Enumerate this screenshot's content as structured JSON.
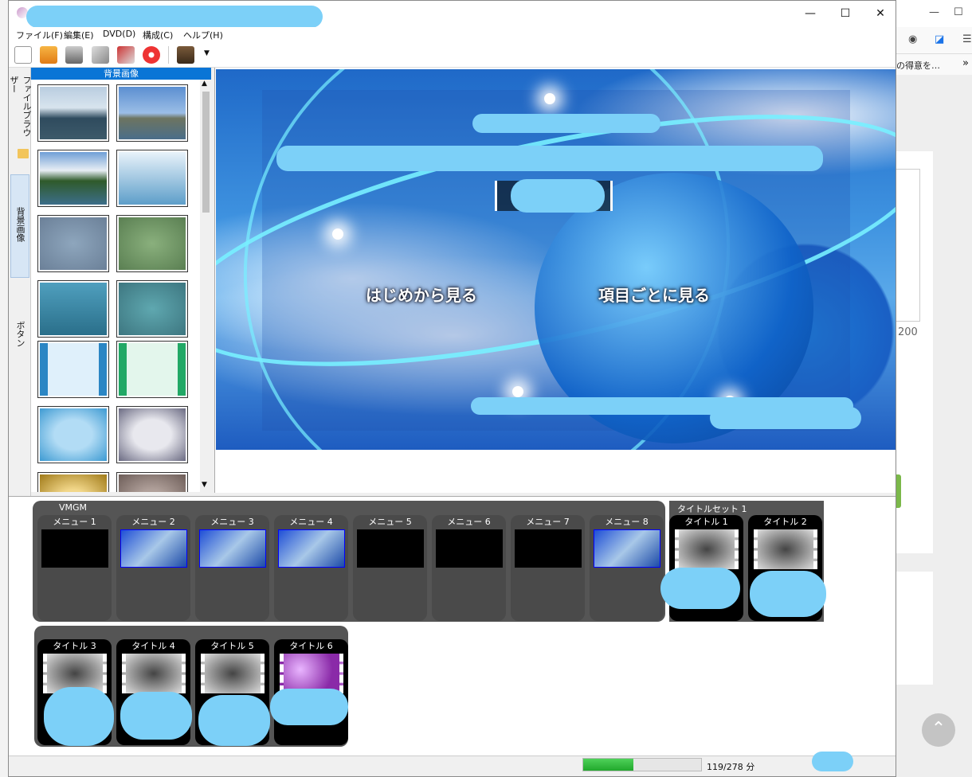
{
  "window": {
    "menu": [
      "ファイル(F)",
      "編集(E)",
      "DVD(D)",
      "構成(C)",
      "ヘルプ(H)"
    ],
    "controls": {
      "minimize": "—",
      "maximize": "☐",
      "close": "✕"
    }
  },
  "side_tabs": {
    "file_browser": "ファイルブラウザー",
    "background": "背景画像",
    "button": "ボタン"
  },
  "pane": {
    "header": "背景画像"
  },
  "preview": {
    "btn_from_start": "はじめから見る",
    "btn_by_item": "項目ごとに見る"
  },
  "lane": {
    "vmgm_label": "VMGM",
    "menus": [
      "メニュー 1",
      "メニュー 2",
      "メニュー 3",
      "メニュー 4",
      "メニュー 5",
      "メニュー 6",
      "メニュー 7",
      "メニュー 8"
    ],
    "titleset_label": "タイトルセット 1",
    "titles_row1": [
      "タイトル 1",
      "タイトル 2"
    ],
    "titles_row2": [
      "タイトル 3",
      "タイトル 4",
      "タイトル 5",
      "タイトル 6"
    ]
  },
  "status": {
    "minutes_text": "119/278 分",
    "usage_fraction": 0.428
  },
  "background_app": {
    "bookmark_text": "の得意を…",
    "char_count": "200",
    "scroll_top_icon": "chevron-up-icon"
  }
}
